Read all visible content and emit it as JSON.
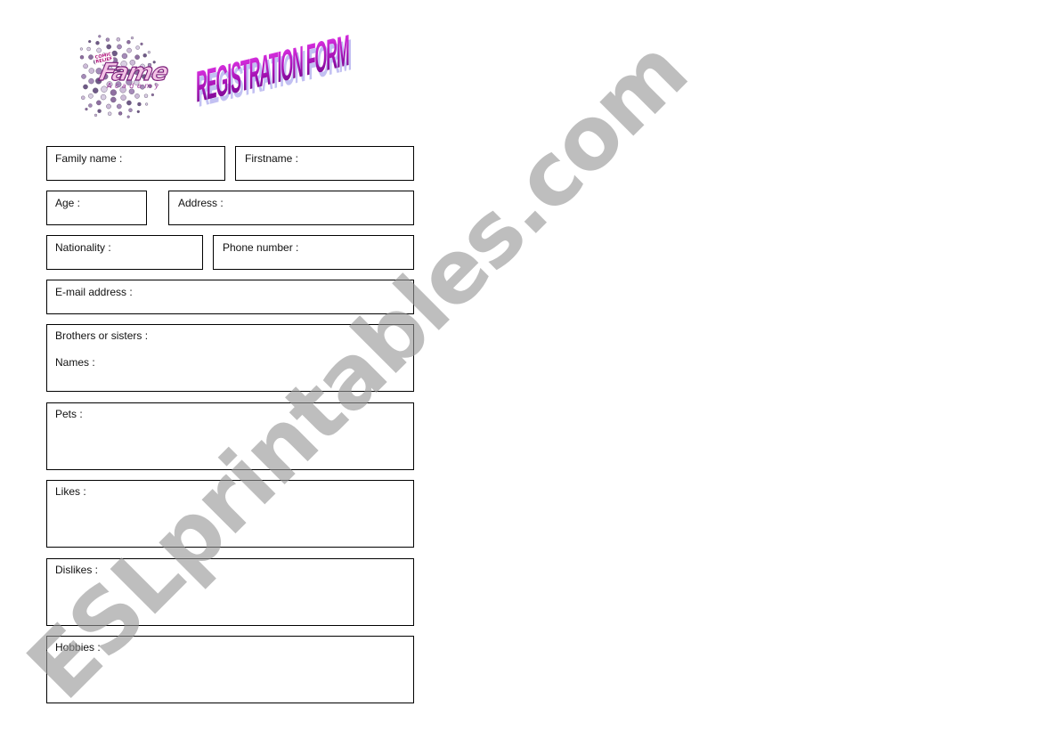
{
  "header": {
    "logo": {
      "brand": "Fame",
      "subtitle": "Academy",
      "badge_line1": "COMIC",
      "badge_line2": "RELIEF",
      "colors": {
        "brand_fill": "#f3c4e6",
        "brand_outline": "#7a1f7a",
        "dots": "#8e6fa0"
      }
    },
    "title": "REGISTRATION FORM",
    "title_colors": {
      "main": "#b11cbf",
      "shadow": "#b8b6f0"
    }
  },
  "form": {
    "fields": {
      "family_name": "Family name :",
      "firstname": "Firstname :",
      "age": "Age :",
      "address": "Address :",
      "nationality": "Nationality :",
      "phone_number": "Phone number :",
      "email_address": "E-mail address :",
      "brothers_or_sisters": "Brothers or sisters :",
      "names": "Names :",
      "pets": "Pets :",
      "likes": "Likes :",
      "dislikes": "Dislikes :",
      "hobbies": "Hobbies :"
    }
  },
  "watermark": {
    "text": "ESLprintables.com",
    "color": "#969696"
  }
}
